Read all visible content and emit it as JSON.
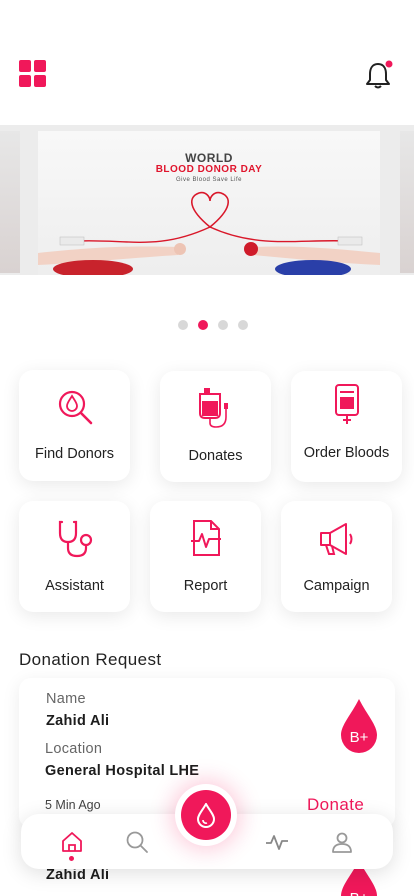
{
  "colors": {
    "accent": "#f0185a",
    "text": "#1d1d1d"
  },
  "header": {
    "menu_icon": "grid-icon",
    "notification_icon": "bell-icon",
    "has_unread": true
  },
  "banner": {
    "title_line1": "WORLD",
    "title_line2": "BLOOD DONOR DAY",
    "tagline": "Give Blood Save Life",
    "slide_count": 4,
    "active_slide": 2
  },
  "actions": [
    {
      "label": "Find Donors",
      "icon": "search-blood-icon"
    },
    {
      "label": "Donates",
      "icon": "blood-bag-icon"
    },
    {
      "label": "Order Bloods",
      "icon": "blood-pack-icon"
    },
    {
      "label": "Assistant",
      "icon": "stethoscope-icon"
    },
    {
      "label": "Report",
      "icon": "report-icon"
    },
    {
      "label": "Campaign",
      "icon": "megaphone-icon"
    }
  ],
  "donation_section": {
    "title": "Donation Request"
  },
  "requests": [
    {
      "name_label": "Name",
      "name": "Zahid Ali",
      "location_label": "Location",
      "location": "General Hospital LHE",
      "time": "5 Min Ago",
      "action": "Donate",
      "blood_group": "B+"
    },
    {
      "name": "Zahid Ali",
      "blood_group": "B+"
    }
  ],
  "bottom_nav": {
    "items": [
      "home-icon",
      "search-icon",
      "blood-drop-icon",
      "activity-icon",
      "profile-icon"
    ],
    "active": "home-icon"
  }
}
